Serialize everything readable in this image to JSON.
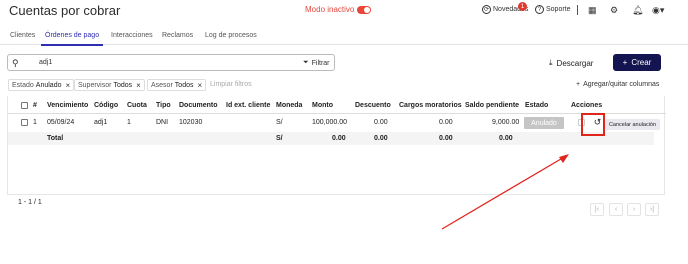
{
  "header": {
    "title": "Cuentas por cobrar",
    "mode_label": "Modo inactivo",
    "novedades_label": "Novedades",
    "novedades_badge": "1",
    "soporte_label": "Soporte"
  },
  "tabs": [
    {
      "label": "Clientes"
    },
    {
      "label": "Órdenes de pago"
    },
    {
      "label": "Interacciones"
    },
    {
      "label": "Reclamos"
    },
    {
      "label": "Log de procesos"
    }
  ],
  "search": {
    "value": "adj1",
    "filter_label": "Filtrar"
  },
  "actions": {
    "download_label": "Descargar",
    "create_label": "Crear",
    "columns_label": "Agregar/quitar columnas"
  },
  "chips": [
    {
      "key": "Estado",
      "value": "Anulado"
    },
    {
      "key": "Supervisor",
      "value": "Todos"
    },
    {
      "key": "Asesor",
      "value": "Todos"
    }
  ],
  "clear_filters": "Limpiar filtros",
  "table": {
    "headers": [
      "#",
      "Vencimiento",
      "Código",
      "Cuota",
      "Tipo",
      "Documento",
      "Id ext. cliente",
      "Moneda",
      "Monto",
      "Descuento",
      "Cargos moratorios",
      "Saldo pendiente",
      "Estado",
      "Acciones"
    ],
    "row": {
      "num": "1",
      "vencimiento": "05/09/24",
      "codigo": "adj1",
      "cuota": "1",
      "tipo": "DNI",
      "documento": "102030",
      "id_ext": "",
      "moneda": "S/",
      "monto": "100,000.00",
      "descuento": "0.00",
      "cargos": "0.00",
      "saldo": "9,000.00",
      "estado": "Anulado"
    },
    "total": {
      "label": "Total",
      "moneda": "S/",
      "monto": "0.00",
      "descuento": "0.00",
      "cargos": "0.00",
      "saldo": "0.00"
    }
  },
  "tooltip": "Cancelar anulación",
  "pagination": {
    "text": "1 - 1 / 1"
  },
  "colors": {
    "accent": "#2f2fb3",
    "primary_button": "#141450",
    "danger": "#e8483c",
    "highlight": "#e0251b"
  }
}
